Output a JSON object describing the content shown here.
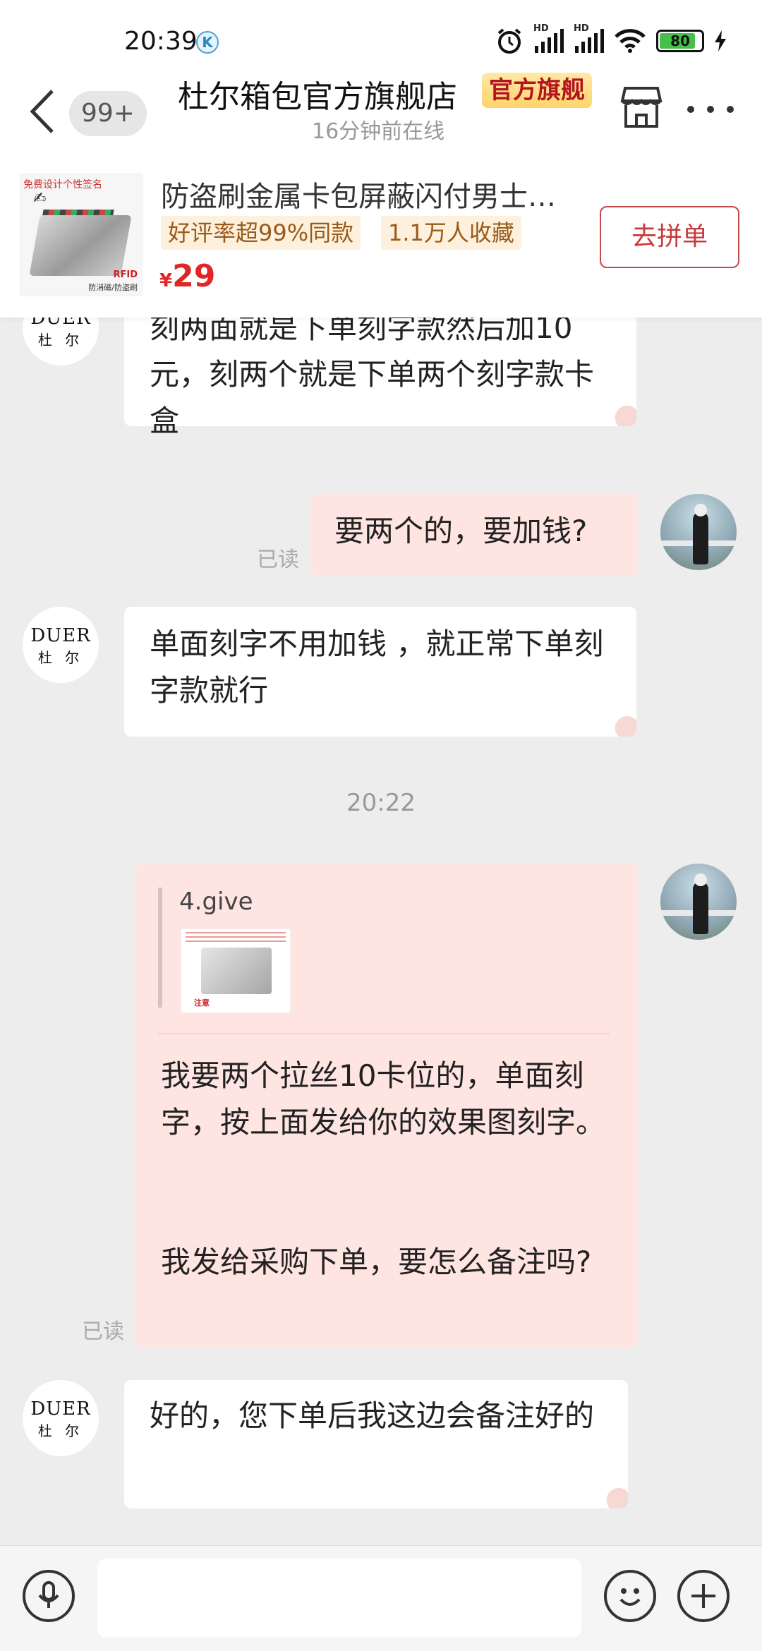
{
  "status_bar": {
    "time": "20:39",
    "k_badge": "K",
    "hd1": "HD",
    "hd2": "HD",
    "battery": "80"
  },
  "header": {
    "unread_count": "99+",
    "shop_name": "杜尔箱包官方旗舰店",
    "official_badge": "官方旗舰",
    "online_status": "16分钟前在线"
  },
  "product": {
    "title": "防盗刷金属卡包屏蔽闪付男士…",
    "tag_rating": "好评率超99%同款",
    "tag_favorites": "1.1万人收藏",
    "price_currency": "¥",
    "price_value": "29",
    "action_button": "去拼单",
    "thumb_top_text": "免费设计个性签名",
    "thumb_rfid": "RFID",
    "thumb_bottom_text": "防消磁/防盗刷"
  },
  "shop_avatar": {
    "en": "DUER",
    "cn": "杜 尔"
  },
  "messages": [
    {
      "side": "in",
      "text": "刻两面就是下单刻字款然后加10元，刻两个就是下单两个刻字款卡盒"
    },
    {
      "side": "out",
      "text": "要两个的，要加钱?",
      "status": "已读"
    },
    {
      "side": "in",
      "text": "单面刻字不用加钱 ，就正常下单刻字款就行"
    },
    {
      "time_separator": "20:22"
    },
    {
      "side": "out",
      "quote_label": "4.give",
      "text_line1": "我要两个拉丝10卡位的，单面刻字，按上面发给你的效果图刻字。",
      "text_line2": "我发给采购下单，要怎么备注吗?",
      "status": "已读"
    },
    {
      "side": "in",
      "text": "好的，您下单后我这边会备注好的"
    }
  ],
  "input": {
    "value": "",
    "placeholder": ""
  },
  "colors": {
    "accent_red": "#e02626",
    "bubble_out": "#ffe5e2",
    "bubble_in": "#ffffff",
    "background": "#ededed"
  }
}
